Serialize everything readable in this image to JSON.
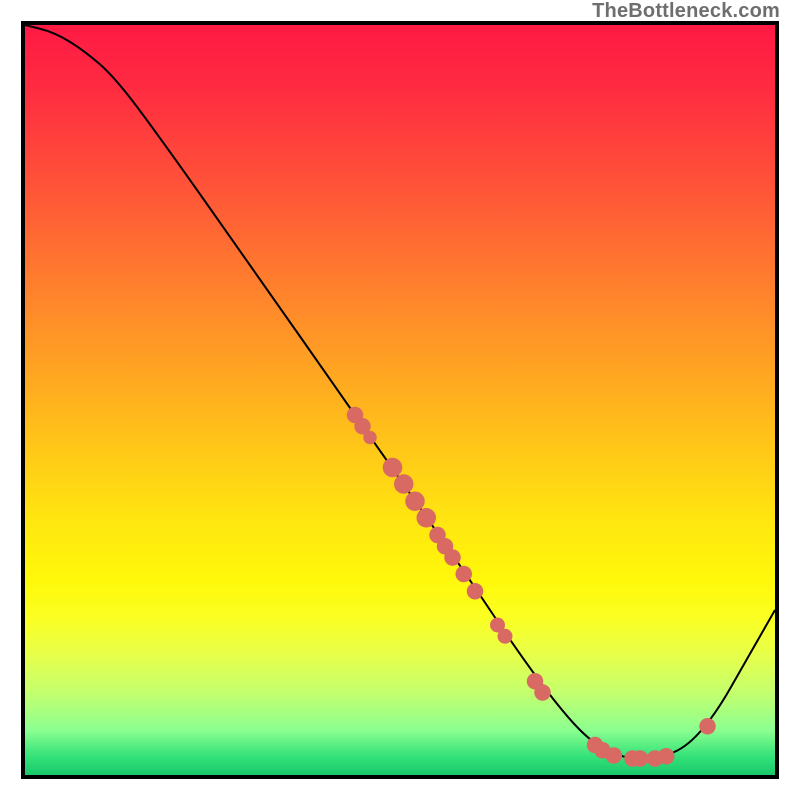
{
  "watermark": "TheBottleneck.com",
  "chart_data": {
    "type": "line",
    "title": "",
    "xlabel": "",
    "ylabel": "",
    "xlim": [
      0,
      100
    ],
    "ylim": [
      0,
      100
    ],
    "curve": [
      {
        "x": 0,
        "y": 100
      },
      {
        "x": 4,
        "y": 99
      },
      {
        "x": 8,
        "y": 96.5
      },
      {
        "x": 12,
        "y": 93
      },
      {
        "x": 18,
        "y": 85
      },
      {
        "x": 30,
        "y": 68
      },
      {
        "x": 44,
        "y": 48
      },
      {
        "x": 58,
        "y": 28
      },
      {
        "x": 66,
        "y": 16
      },
      {
        "x": 72,
        "y": 8
      },
      {
        "x": 76,
        "y": 4
      },
      {
        "x": 80,
        "y": 2.2
      },
      {
        "x": 84,
        "y": 2.2
      },
      {
        "x": 88,
        "y": 3.5
      },
      {
        "x": 92,
        "y": 8
      },
      {
        "x": 96,
        "y": 15
      },
      {
        "x": 100,
        "y": 22
      }
    ],
    "points": [
      {
        "x": 44,
        "y": 48,
        "r": 1.1
      },
      {
        "x": 45,
        "y": 46.5,
        "r": 1.1
      },
      {
        "x": 46,
        "y": 45,
        "r": 0.9
      },
      {
        "x": 49,
        "y": 41,
        "r": 1.3
      },
      {
        "x": 50.5,
        "y": 38.8,
        "r": 1.3
      },
      {
        "x": 52,
        "y": 36.5,
        "r": 1.3
      },
      {
        "x": 53.5,
        "y": 34.3,
        "r": 1.3
      },
      {
        "x": 55,
        "y": 32,
        "r": 1.1
      },
      {
        "x": 56,
        "y": 30.5,
        "r": 1.1
      },
      {
        "x": 57,
        "y": 29,
        "r": 1.1
      },
      {
        "x": 58.5,
        "y": 26.8,
        "r": 1.1
      },
      {
        "x": 60,
        "y": 24.5,
        "r": 1.1
      },
      {
        "x": 63,
        "y": 20,
        "r": 1.0
      },
      {
        "x": 64,
        "y": 18.5,
        "r": 1.0
      },
      {
        "x": 68,
        "y": 12.5,
        "r": 1.1
      },
      {
        "x": 69,
        "y": 11,
        "r": 1.1
      },
      {
        "x": 76,
        "y": 4,
        "r": 1.1
      },
      {
        "x": 77,
        "y": 3.3,
        "r": 1.1
      },
      {
        "x": 78.5,
        "y": 2.6,
        "r": 1.1
      },
      {
        "x": 81,
        "y": 2.2,
        "r": 1.1
      },
      {
        "x": 82,
        "y": 2.2,
        "r": 1.1
      },
      {
        "x": 84,
        "y": 2.2,
        "r": 1.1
      },
      {
        "x": 85.5,
        "y": 2.5,
        "r": 1.1
      },
      {
        "x": 91,
        "y": 6.5,
        "r": 1.1
      }
    ],
    "colors": {
      "curve": "#000000",
      "dot": "#d86a63"
    }
  }
}
